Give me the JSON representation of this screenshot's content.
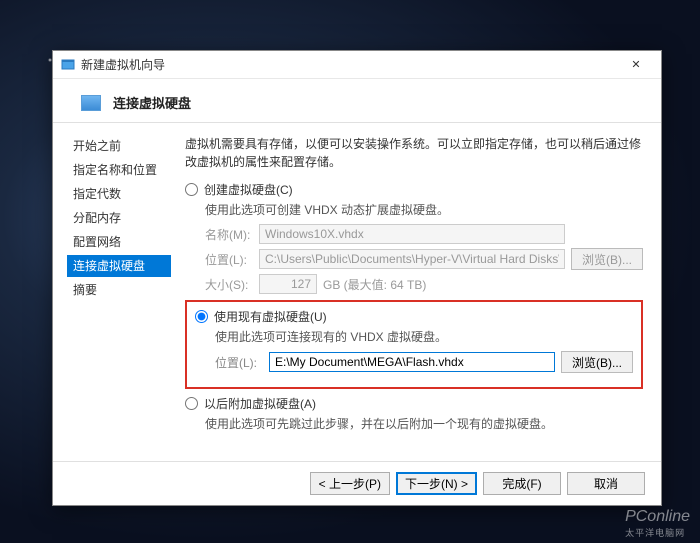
{
  "window": {
    "title": "新建虚拟机向导",
    "close_glyph": "✕"
  },
  "header": {
    "title": "连接虚拟硬盘"
  },
  "sidebar": {
    "items": [
      {
        "label": "开始之前"
      },
      {
        "label": "指定名称和位置"
      },
      {
        "label": "指定代数"
      },
      {
        "label": "分配内存"
      },
      {
        "label": "配置网络"
      },
      {
        "label": "连接虚拟硬盘"
      },
      {
        "label": "摘要"
      }
    ],
    "active_index": 5
  },
  "main": {
    "intro": "虚拟机需要具有存储，以便可以安装操作系统。可以立即指定存储，也可以稍后通过修改虚拟机的属性来配置存储。",
    "option_create": {
      "label": "创建虚拟硬盘(C)",
      "desc": "使用此选项可创建 VHDX 动态扩展虚拟硬盘。",
      "name_label": "名称(M):",
      "name_value": "Windows10X.vhdx",
      "loc_label": "位置(L):",
      "loc_value": "C:\\Users\\Public\\Documents\\Hyper-V\\Virtual Hard Disks\\",
      "browse_label": "浏览(B)...",
      "size_label": "大小(S):",
      "size_value": "127",
      "size_unit": "GB (最大值: 64 TB)"
    },
    "option_existing": {
      "label": "使用现有虚拟硬盘(U)",
      "desc": "使用此选项可连接现有的 VHDX 虚拟硬盘。",
      "loc_label": "位置(L):",
      "loc_value": "E:\\My Document\\MEGA\\Flash.vhdx",
      "browse_label": "浏览(B)..."
    },
    "option_later": {
      "label": "以后附加虚拟硬盘(A)",
      "desc": "使用此选项可先跳过此步骤，并在以后附加一个现有的虚拟硬盘。"
    },
    "selected_option": "existing"
  },
  "footer": {
    "prev": "< 上一步(P)",
    "next": "下一步(N) >",
    "finish": "完成(F)",
    "cancel": "取消"
  },
  "watermark": {
    "brand": "PConline",
    "sub": "太平洋电脑网"
  }
}
